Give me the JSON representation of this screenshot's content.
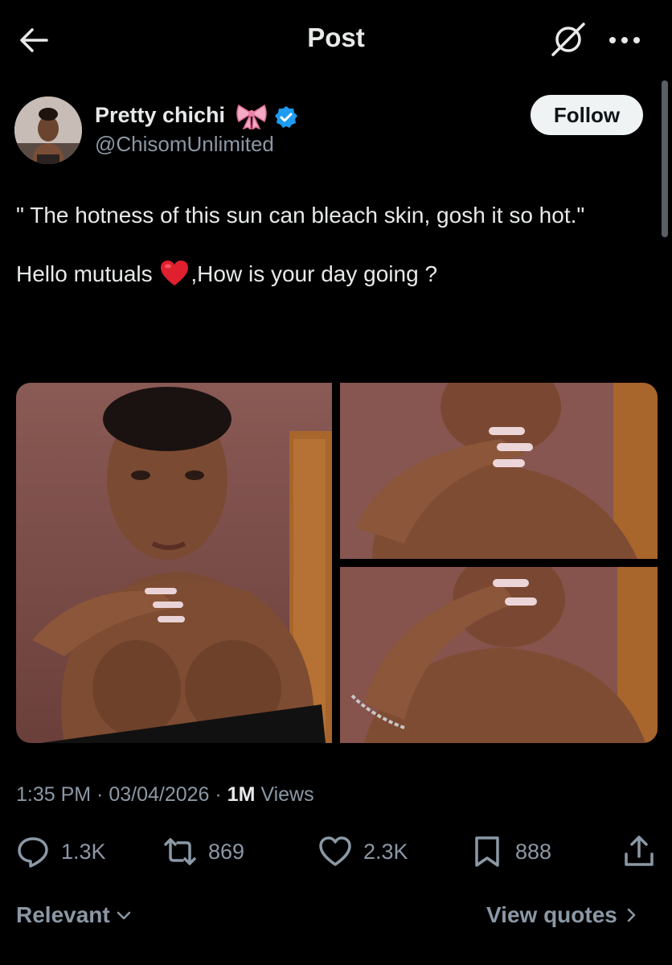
{
  "header": {
    "title": "Post",
    "back_icon": "arrow-left-icon",
    "grok_icon": "grok-icon",
    "more_icon": "more-horizontal-icon"
  },
  "author": {
    "display_name": "Pretty chichi",
    "name_emoji": "ribbon-bow-icon",
    "verified": "verified-badge-icon",
    "handle": "@ChisomUnlimited",
    "follow_label": "Follow"
  },
  "post": {
    "line1": "\" The hotness of this sun can bleach skin, gosh it so hot.\"",
    "line2_before": "Hello mutuals ",
    "line2_emoji": "red-heart-icon",
    "line2_after": ",How is your day going ?",
    "images": [
      "photo-1",
      "photo-2",
      "photo-3"
    ]
  },
  "meta": {
    "time": "1:35 PM",
    "sep1": " · ",
    "date": "03/04/2026",
    "sep2": " · ",
    "views_count": "1M",
    "views_label": " Views"
  },
  "actions": {
    "replies": "1.3K",
    "reposts": "869",
    "likes": "2.3K",
    "bookmarks": "888"
  },
  "footer": {
    "relevant_label": "Relevant",
    "view_quotes_label": "View quotes"
  },
  "colors": {
    "background": "#000000",
    "text": "#e7e9ea",
    "muted": "#8b98a5",
    "verified": "#1d9bf0",
    "follow_bg": "#eff3f4"
  }
}
